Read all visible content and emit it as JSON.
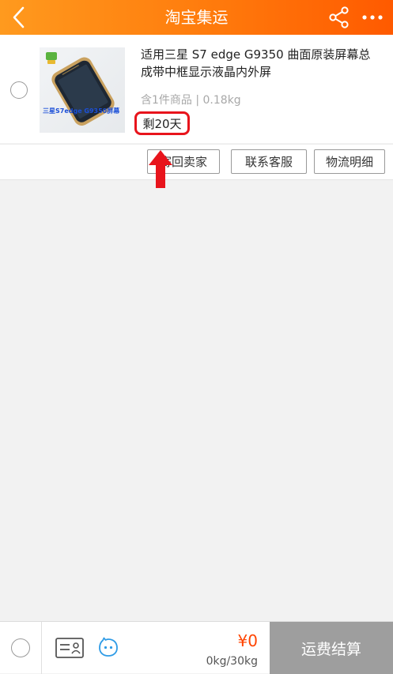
{
  "header": {
    "title": "淘宝集运",
    "gradient": [
      "#ff9a1e",
      "#ff5a00"
    ]
  },
  "item": {
    "title": "适用三星 S7 edge G9350 曲面原装屏幕总成带中框显示液晶内外屏",
    "meta": "含1件商品 | 0.18kg",
    "remaining": "剩20天",
    "thumbnail_caption": "三星S7edge G9350屏幕",
    "thumbnail_icon": "phone-product-image"
  },
  "actions": {
    "return_label": "寄回卖家",
    "service_label": "联系客服",
    "logistics_label": "物流明细"
  },
  "annotation": {
    "color": "#e8141c",
    "arrow_icon": "red-up-arrow-icon"
  },
  "footer": {
    "price": "¥0",
    "weight": "0kg/30kg",
    "checkout_label": "运费结算",
    "icons": [
      "id-card-icon",
      "smiley-face-icon"
    ],
    "price_color": "#ff4400"
  }
}
